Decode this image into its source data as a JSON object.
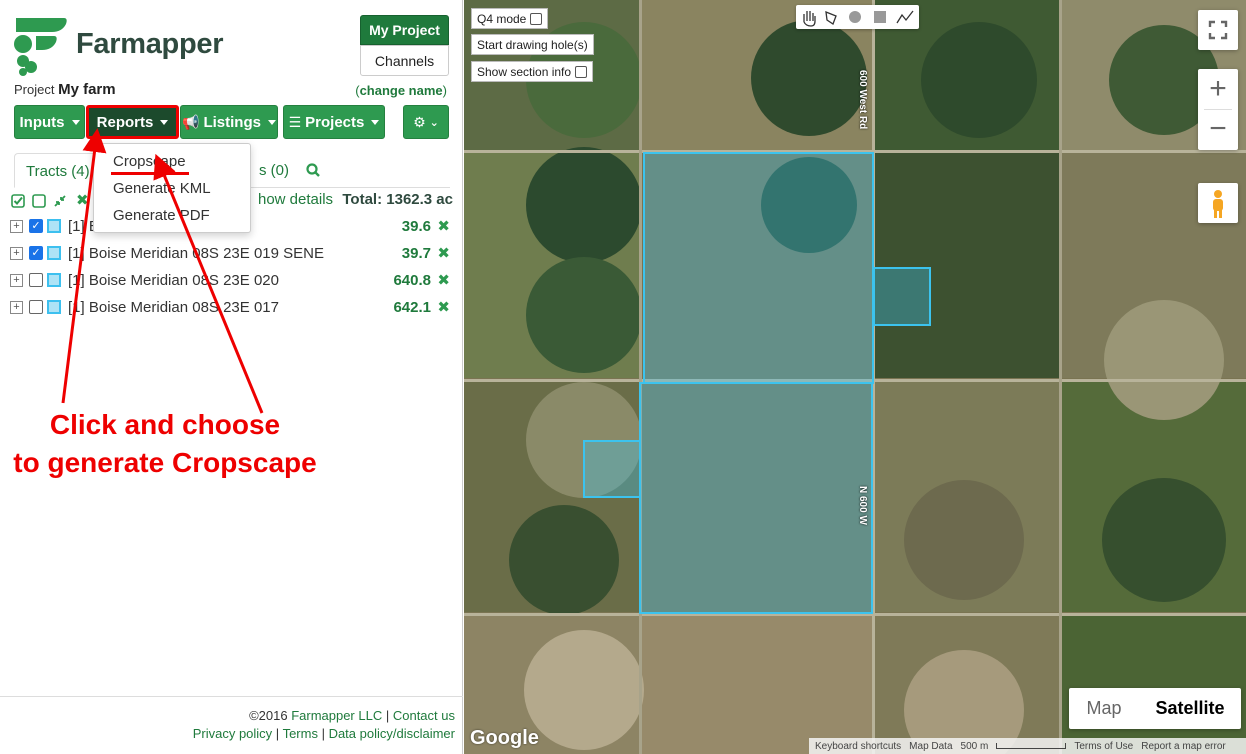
{
  "brand": {
    "name": "Farmapper"
  },
  "header": {
    "my_project": "My Project",
    "channels": "Channels"
  },
  "project": {
    "label": "Project",
    "name": "My farm",
    "change_name_prefix": "(",
    "change_name": "change name",
    "change_name_suffix": ")"
  },
  "nav": {
    "inputs": "Inputs",
    "reports": "Reports",
    "listings": "Listings",
    "projects": "Projects"
  },
  "reports_menu": [
    "Cropscape",
    "Generate KML",
    "Generate PDF"
  ],
  "tabs": {
    "tracts": "Tracts (4)",
    "other": "s (0)"
  },
  "list_toolbar": {
    "show_details": "how details",
    "total": "Total: 1362.3 ac"
  },
  "tracts": [
    {
      "name": "[1] B                            E 016 NWSW",
      "acres": "39.6",
      "checked": true
    },
    {
      "name": "[1] Boise Meridian 08S 23E 019 SENE",
      "acres": "39.7",
      "checked": true
    },
    {
      "name": "[1] Boise Meridian 08S 23E 020",
      "acres": "640.8",
      "checked": false
    },
    {
      "name": "[1] Boise Meridian 08S 23E 017",
      "acres": "642.1",
      "checked": false
    }
  ],
  "annotation": {
    "line1": "Click and choose",
    "line2": "to generate Cropscape"
  },
  "footer": {
    "copyright": "©2016",
    "company": "Farmapper LLC",
    "contact": "Contact us",
    "privacy": "Privacy policy",
    "terms": "Terms",
    "data_policy": "Data policy/disclaimer"
  },
  "map": {
    "q4_mode": "Q4 mode",
    "start_drawing_holes": "Start drawing hole(s)",
    "show_section_info": "Show section info",
    "map_type": "Map",
    "satellite": "Satellite",
    "google": "Google",
    "attribution": [
      "Keyboard shortcuts",
      "Map Data",
      "500 m",
      "Terms of Use",
      "Report a map error"
    ],
    "road_labels": [
      "600 West Rd",
      "N 600 W"
    ],
    "zoom_in": "+",
    "zoom_out": "−"
  },
  "colors": {
    "accent": "#2e9a50",
    "brand_dark": "#2f4a3f",
    "highlight": "#e00000",
    "tract_fill": "#3cc3ee"
  }
}
